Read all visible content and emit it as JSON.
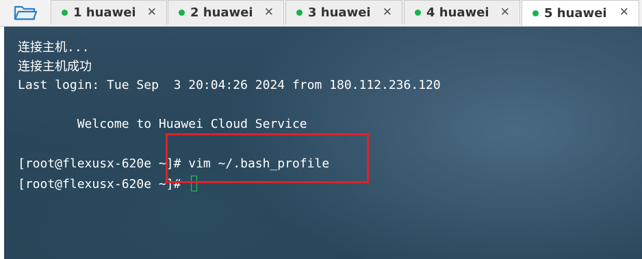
{
  "tabs": [
    {
      "label": "1 huawei",
      "active": false,
      "close": "✕"
    },
    {
      "label": "2 huawei",
      "active": false,
      "close": "✕"
    },
    {
      "label": "3 huawei",
      "active": false,
      "close": "✕"
    },
    {
      "label": "4 huawei",
      "active": false,
      "close": "✕"
    },
    {
      "label": "5 huawei",
      "active": true,
      "close": "✕"
    }
  ],
  "colors": {
    "tab_dot": "#17b24a",
    "terminal_bg": "#2f4c62",
    "terminal_text": "#ffffff",
    "cursor": "#2ecc55",
    "highlight": "#e0222a"
  },
  "terminal": {
    "lines": [
      "连接主机...",
      "连接主机成功",
      "Last login: Tue Sep  3 20:04:26 2024 from 180.112.236.120",
      "        Welcome to Huawei Cloud Service",
      "[root@flexusx-620e ~]# vim ~/.bash_profile",
      "[root@flexusx-620e ~]# "
    ]
  }
}
